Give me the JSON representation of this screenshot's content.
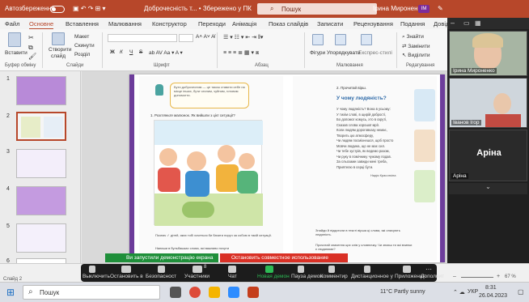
{
  "titlebar": {
    "autosave": "Автозбереження",
    "doc_title": "Доброчесність т... • Збережено у ПК",
    "search_placeholder": "Пошук",
    "user": "Ірина Мироненко",
    "user_initials": "ІМ"
  },
  "tabs": [
    "Файл",
    "Основне",
    "Вставлення",
    "Малювання",
    "Конструктор",
    "Переходи",
    "Анімація",
    "Показ слайдів",
    "Записати",
    "Рецензування",
    "Подання",
    "Довідка"
  ],
  "active_tab": "Основне",
  "ribbon": {
    "paste": "Вставити",
    "new_slide_1": "Створити",
    "new_slide_2": "слайд",
    "layout": "Макет",
    "reset": "Скинути",
    "section": "Розділ",
    "bold": "Ж",
    "italic": "К",
    "underline": "Ч",
    "strike": "S",
    "figures": "Фігури",
    "arrange": "Упорядкувати",
    "styles": "Експрес-стилі",
    "find": "Знайти",
    "replace": "Замінити",
    "select": "Виділити",
    "groups": {
      "clipboard": "Буфер обміну",
      "slides": "Слайди",
      "font": "Шрифт",
      "paragraph": "Абзац",
      "drawing": "Малювання",
      "editing": "Редагування"
    }
  },
  "thumbnails": [
    {
      "num": "1",
      "bg": "#b88ad8"
    },
    {
      "num": "2",
      "bg": "#f5f5f5"
    },
    {
      "num": "3",
      "bg": "#f3eefa"
    },
    {
      "num": "4",
      "bg": "#c49be0"
    },
    {
      "num": "5",
      "bg": "#f4f0fb"
    },
    {
      "num": "6",
      "bg": "#ffffff"
    }
  ],
  "slide": {
    "left_intro": "Бути доброчесним — це також ставити себе на місце інших, бути чесним, чуйним, готовим допомогти.",
    "left_task": "1. Розгляньте малюнок. Як вийшли з цієї ситуації?",
    "bullet_1": "Познач ✓ дітей, яких тобі хочеться би бачити поруч за собою в такій ситуації.",
    "bullet_2": "Напиши в бульбашках слова, які важливо почути",
    "right_task": "2. Прочитай вірш.",
    "poem_title": "У чому людяність?",
    "poem_lines": [
      "У чому людяність? Вона в усьому:",
      "У тихім слові, в щирій добрості,",
      "Бо допомог комусь, хто в скруті,",
      "Сказав слова хорошої мрії.",
      "Коли людям дороговказу немає,",
      "Творить цю атмосферу,",
      "Чи людям посміхнешся, щоб просто",
      "Мовчи людина, що не має сил.",
      "Чи тебе зустрів, як ведемо разом,",
      "Чи руку в помічнику чужому подав.",
      "За сльозами завжди мені треба,",
      "Приятелю в серці бути."
    ],
    "poem_author": "Надія Красоткіна",
    "q_1": "Знайди й підкресли в тексті вірша ці слова, які описують людяність.",
    "q_2": "Прочитай значення цих слів у словничку. Чи знаєш ти які вчинки є людяними?"
  },
  "video": {
    "participants": [
      {
        "name": "Ірина Мироненко"
      },
      {
        "name": "Іванов Ігор"
      },
      {
        "name": "Аріна",
        "placeholder": "Аріна"
      }
    ]
  },
  "share": {
    "banner": "Ви запустили демонстрацію екрана",
    "stop": "Остановить совместное использование"
  },
  "meeting_controls": {
    "mute": "Выключить",
    "stop_video": "Остановить в",
    "security": "Безопасност",
    "participants": "Участники",
    "participants_count": "8",
    "chat": "Чат",
    "new_demo": "Новая демон",
    "pause": "Пауза демон",
    "annotate": "Комментир",
    "remote": "Дистанционное у",
    "apps": "Приложения",
    "more": "Дополнит"
  },
  "statusbar": {
    "slide": "Слайд 2",
    "zoom": "67 %"
  },
  "taskbar": {
    "search": "Пошук",
    "weather": "11°C Partly sunny",
    "lang": "УКР",
    "time": "8:31",
    "date": "26.04.2023"
  }
}
